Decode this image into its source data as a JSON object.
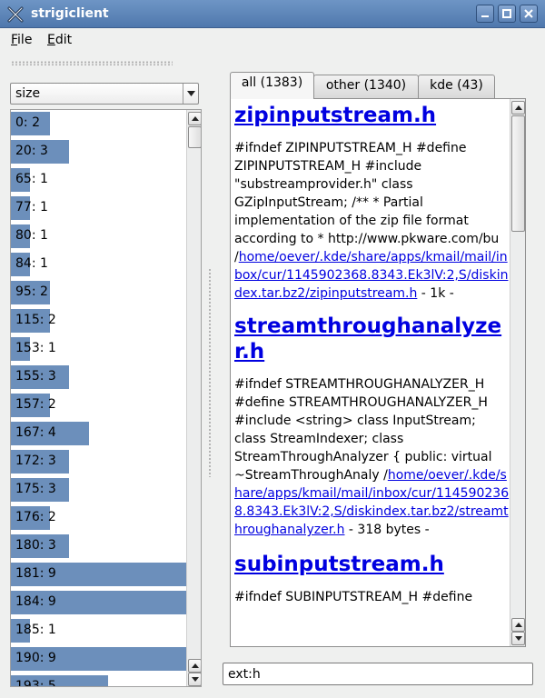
{
  "window": {
    "title": "strigiclient"
  },
  "menu": {
    "file": {
      "mnemonic": "F",
      "rest": "ile"
    },
    "edit": {
      "mnemonic": "E",
      "rest": "dit"
    }
  },
  "facet": {
    "selected": "size",
    "histogram": [
      {
        "label": "0: 2",
        "count": 2
      },
      {
        "label": "20: 3",
        "count": 3
      },
      {
        "label": "65: 1",
        "count": 1
      },
      {
        "label": "77: 1",
        "count": 1
      },
      {
        "label": "80: 1",
        "count": 1
      },
      {
        "label": "84: 1",
        "count": 1
      },
      {
        "label": "95: 2",
        "count": 2
      },
      {
        "label": "115: 2",
        "count": 2
      },
      {
        "label": "153: 1",
        "count": 1
      },
      {
        "label": "155: 3",
        "count": 3
      },
      {
        "label": "157: 2",
        "count": 2
      },
      {
        "label": "167: 4",
        "count": 4
      },
      {
        "label": "172: 3",
        "count": 3
      },
      {
        "label": "175: 3",
        "count": 3
      },
      {
        "label": "176: 2",
        "count": 2
      },
      {
        "label": "180: 3",
        "count": 3
      },
      {
        "label": "181: 9",
        "count": 9
      },
      {
        "label": "184: 9",
        "count": 9
      },
      {
        "label": "185: 1",
        "count": 1
      },
      {
        "label": "190: 9",
        "count": 9
      },
      {
        "label": "193: 5",
        "count": 5
      }
    ],
    "max_count": 9
  },
  "tabs": [
    {
      "label": "all (1383)",
      "active": true
    },
    {
      "label": "other (1340)",
      "active": false
    },
    {
      "label": "kde (43)",
      "active": false
    }
  ],
  "results": [
    {
      "title": "zipinputstream.h",
      "snippet": "#ifndef ZIPINPUTSTREAM_H #define ZIPINPUTSTREAM_H #include \"substreamprovider.h\" class GZipInputStream; /** * Partial implementation of the zip file format according to * http://www.pkware.com/bu /",
      "path": "home/oever/.kde/share/apps/kmail/mail/inbox/cur/1145902368.8343.Ek3lV:2,S/diskindex.tar.bz2/zipinputstream.h",
      "size": " - 1k -"
    },
    {
      "title": "streamthroughanalyzer.h",
      "snippet": "#ifndef STREAMTHROUGHANALYZER_H #define STREAMTHROUGHANALYZER_H #include <string> class InputStream; class StreamIndexer; class StreamThroughAnalyzer { public: virtual ~StreamThroughAnaly /",
      "path": "home/oever/.kde/share/apps/kmail/mail/inbox/cur/1145902368.8343.Ek3lV:2,S/diskindex.tar.bz2/streamthroughanalyzer.h",
      "size": " - 318 bytes -"
    },
    {
      "title": "subinputstream.h",
      "snippet": "#ifndef SUBINPUTSTREAM_H #define",
      "path": "",
      "size": ""
    }
  ],
  "search": {
    "query": "ext:h"
  },
  "colors": {
    "bar": "#6c8fbb",
    "link": "#0000e0",
    "titlebar": "#5a82b8"
  }
}
